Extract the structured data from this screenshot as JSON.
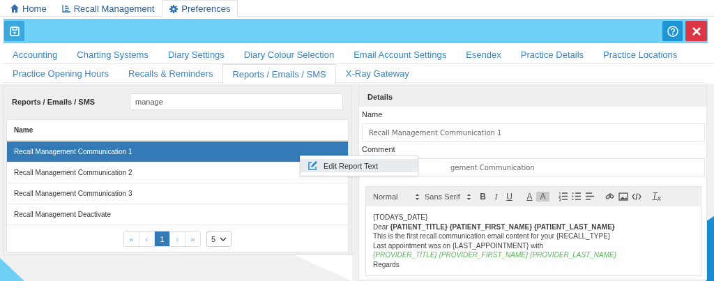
{
  "nav_tabs": [
    {
      "label": "Home",
      "selected": false
    },
    {
      "label": "Recall Management",
      "selected": false
    },
    {
      "label": "Preferences",
      "selected": true
    }
  ],
  "preference_tabs": [
    [
      {
        "label": "Accounting",
        "selected": false
      },
      {
        "label": "Charting Systems",
        "selected": false
      },
      {
        "label": "Diary Settings",
        "selected": false
      },
      {
        "label": "Diary Colour Selection",
        "selected": false
      },
      {
        "label": "Email Account Settings",
        "selected": false
      },
      {
        "label": "Esendex",
        "selected": false
      },
      {
        "label": "Practice Details",
        "selected": false
      },
      {
        "label": "Practice Locations",
        "selected": false
      }
    ],
    [
      {
        "label": "Practice Opening Hours",
        "selected": false
      },
      {
        "label": "Recalls & Reminders",
        "selected": false
      },
      {
        "label": "Reports / Emails / SMS",
        "selected": true
      },
      {
        "label": "X-Ray Gateway",
        "selected": false
      }
    ]
  ],
  "list_panel": {
    "title": "Reports / Emails / SMS",
    "search": {
      "value": "manage"
    },
    "table": {
      "columns": [
        "Name"
      ],
      "rows": [
        {
          "name": "Recall Management Communication 1",
          "selected": true
        },
        {
          "name": "Recall Management Communication 2",
          "selected": false
        },
        {
          "name": "Recall Management Communication 3",
          "selected": false
        },
        {
          "name": "Recall Management Deactivate",
          "selected": false
        }
      ]
    },
    "pagination": {
      "pages": [
        {
          "label": "«",
          "selected": false
        },
        {
          "label": "‹",
          "selected": false
        },
        {
          "label": "1",
          "selected": true
        },
        {
          "label": "›",
          "selected": false
        },
        {
          "label": "»",
          "selected": false
        }
      ],
      "page_size": "5"
    }
  },
  "context_menu": {
    "items": [
      "Edit Report Text"
    ]
  },
  "details": {
    "title": "Details",
    "fields": [
      {
        "label": "Name",
        "value": "Recall Management Communication 1"
      },
      {
        "label": "Comment",
        "value": "gement Communication"
      }
    ],
    "editor": {
      "header_select": "Normal",
      "font_select": "Sans Serif",
      "format_glyphs": [
        "B",
        "I",
        "U",
        "A",
        "A"
      ],
      "clear_format": "T$_{x}$",
      "lines": [
        {
          "kind": "plain",
          "text": "{TODAYS_DATE}"
        },
        {
          "kind": "plain",
          "text": "Dear **{PATIENT_TITLE} {PATIENT_FIRST_NAME} {PATIENT_LAST_NAME}**"
        },
        {
          "kind": "plain",
          "text": "This is the first recall communication email content for your {RECALL_TYPE}"
        },
        {
          "kind": "plain",
          "text": "Last appointment was on {LAST_APPOINTMENT} with"
        },
        {
          "kind": "tag",
          "text": "{PROVIDER_TITLE} {PROVIDER_FIRST_NAME} {PROVIDER_LAST_NAME}"
        },
        {
          "kind": "plain",
          "text": "Regards"
        }
      ]
    }
  }
}
